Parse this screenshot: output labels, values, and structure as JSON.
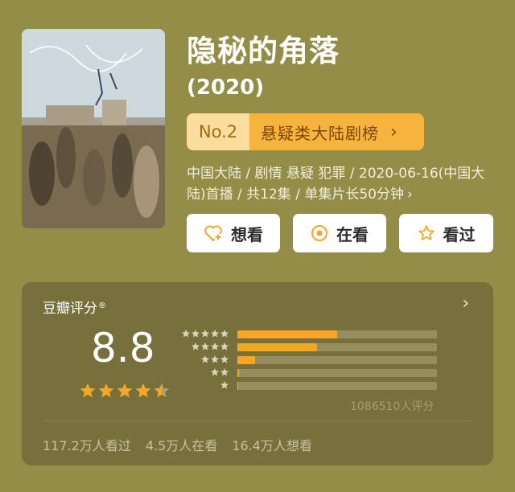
{
  "movie": {
    "title": "隐秘的角落",
    "year": "(2020)",
    "poster_alt": "隐秘的角落 poster"
  },
  "rank": {
    "number": "No.2",
    "label": "悬疑类大陆剧榜",
    "chevron": "chevron-right-icon"
  },
  "info": {
    "line": "中国大陆 / 剧情 悬疑 犯罪 / 2020-06-16(中国大陆)首播 / 共12集 / 单集片长50分钟"
  },
  "actions": {
    "want_label": "想看",
    "doing_label": "在看",
    "done_label": "看过",
    "want_icon": "heart-plus-icon",
    "doing_icon": "target-icon",
    "done_icon": "star-outline-icon"
  },
  "rating": {
    "header": "豆瓣评分",
    "header_mark": "®",
    "score": "8.8",
    "stars_filled": 4.5,
    "distribution": [
      {
        "stars": 5,
        "fraction": 0.5
      },
      {
        "stars": 4,
        "fraction": 0.4
      },
      {
        "stars": 3,
        "fraction": 0.09
      },
      {
        "stars": 2,
        "fraction": 0.01
      },
      {
        "stars": 1,
        "fraction": 0.005
      }
    ],
    "votes": "1086510人评分",
    "stats": {
      "watched": "117.2万人看过",
      "watching": "4.5万人在看",
      "want": "16.4万人想看"
    }
  },
  "colors": {
    "background": "#948d47",
    "card": "#77703d",
    "accent": "#f5a623",
    "rank_bg": "#f6b33e",
    "rank_no_bg": "#fbdd9f"
  }
}
